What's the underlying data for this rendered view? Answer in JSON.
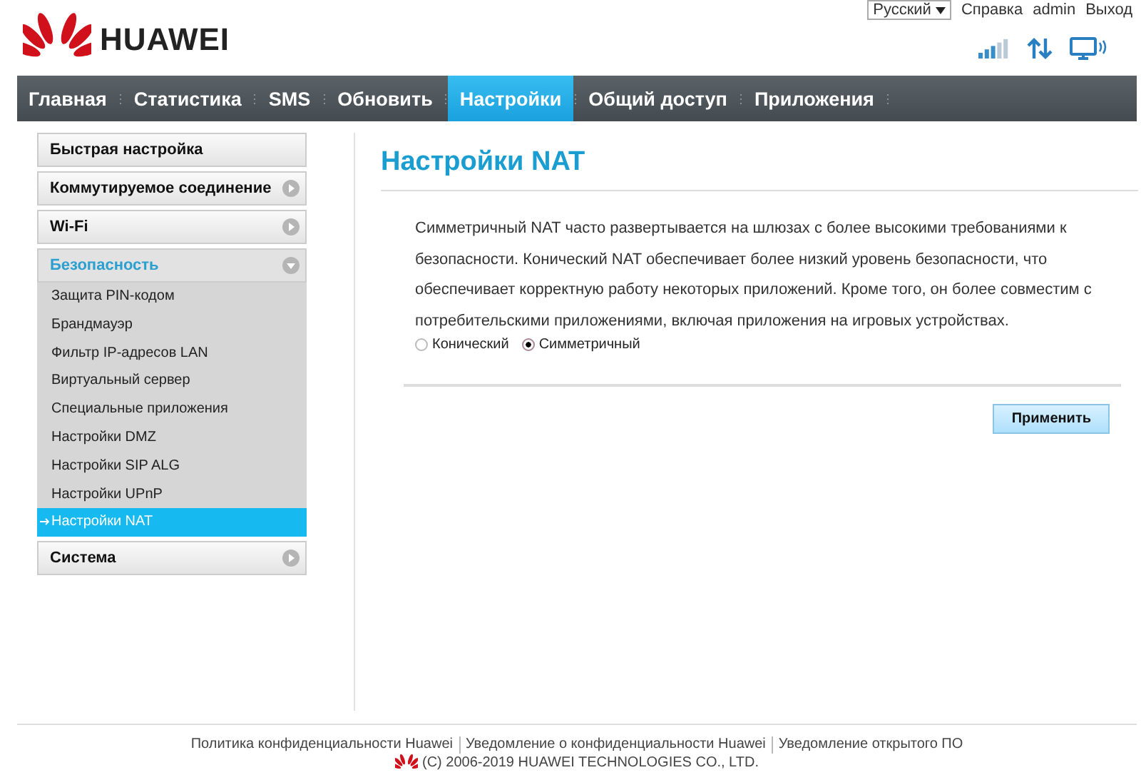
{
  "header": {
    "logo": "HUAWEI",
    "language": "Русский",
    "links": [
      "Справка",
      "admin",
      "Выход"
    ]
  },
  "nav": [
    {
      "label": "Главная",
      "selected": false
    },
    {
      "label": "Статистика",
      "selected": false
    },
    {
      "label": "SMS",
      "selected": false
    },
    {
      "label": "Обновить",
      "selected": false
    },
    {
      "label": "Настройки",
      "selected": true
    },
    {
      "label": "Общий доступ",
      "selected": false
    },
    {
      "label": "Приложения",
      "selected": false
    }
  ],
  "sidebar": [
    {
      "label": "Быстрая настройка",
      "kind": "link"
    },
    {
      "label": "Коммутируемое соединение",
      "kind": "group",
      "expanded": false
    },
    {
      "label": "Wi-Fi",
      "kind": "group",
      "expanded": false
    },
    {
      "label": "Безопасность",
      "kind": "group",
      "expanded": true,
      "children": [
        {
          "label": "Защита PIN-кодом",
          "selected": false
        },
        {
          "label": "Брандмауэр",
          "selected": false
        },
        {
          "label": "Фильтр IP-адресов LAN",
          "selected": false
        },
        {
          "label": "Виртуальный сервер",
          "selected": false
        },
        {
          "label": "Специальные приложения",
          "selected": false
        },
        {
          "label": "Настройки DMZ",
          "selected": false
        },
        {
          "label": "Настройки SIP ALG",
          "selected": false
        },
        {
          "label": "Настройки UPnP",
          "selected": false
        },
        {
          "label": "Настройки NAT",
          "selected": true
        }
      ]
    },
    {
      "label": "Система",
      "kind": "group",
      "expanded": false
    }
  ],
  "content": {
    "title": "Настройки NAT",
    "description": "Симметричный NAT часто развертывается на шлюзах с более высокими требованиями к безопасности. Конический NAT обеспечивает более низкий уровень безопасности, что обеспечивает корректную работу некоторых приложений. Кроме того, он более совместим с потребительскими приложениями, включая приложения на игровых устройствах.",
    "options": [
      {
        "label": "Конический",
        "selected": false
      },
      {
        "label": "Симметричный",
        "selected": true
      }
    ],
    "apply_button": "Применить"
  },
  "footer": {
    "links": [
      "Политика конфиденциальности Huawei",
      "Уведомление о конфиденциальности Huawei",
      "Уведомление открытого ПО"
    ],
    "copyright": "(C) 2006-2019 HUAWEI TECHNOLOGIES CO., LTD."
  }
}
